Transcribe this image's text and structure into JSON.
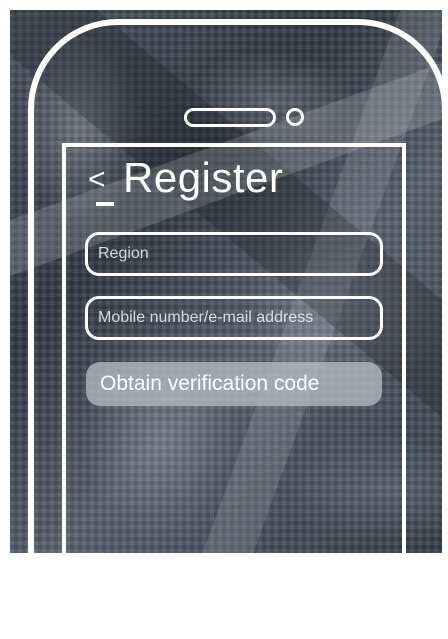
{
  "header": {
    "back_glyph": "<",
    "title": "Register"
  },
  "form": {
    "region_placeholder": "Region",
    "mobile_placeholder": "Mobile number/e-mail address",
    "obtain_button_label": "Obtain verification code"
  },
  "icons": {
    "back": "chevron-left-icon"
  },
  "colors": {
    "foreground": "#ffffff",
    "button_fill": "#b4bac0"
  }
}
